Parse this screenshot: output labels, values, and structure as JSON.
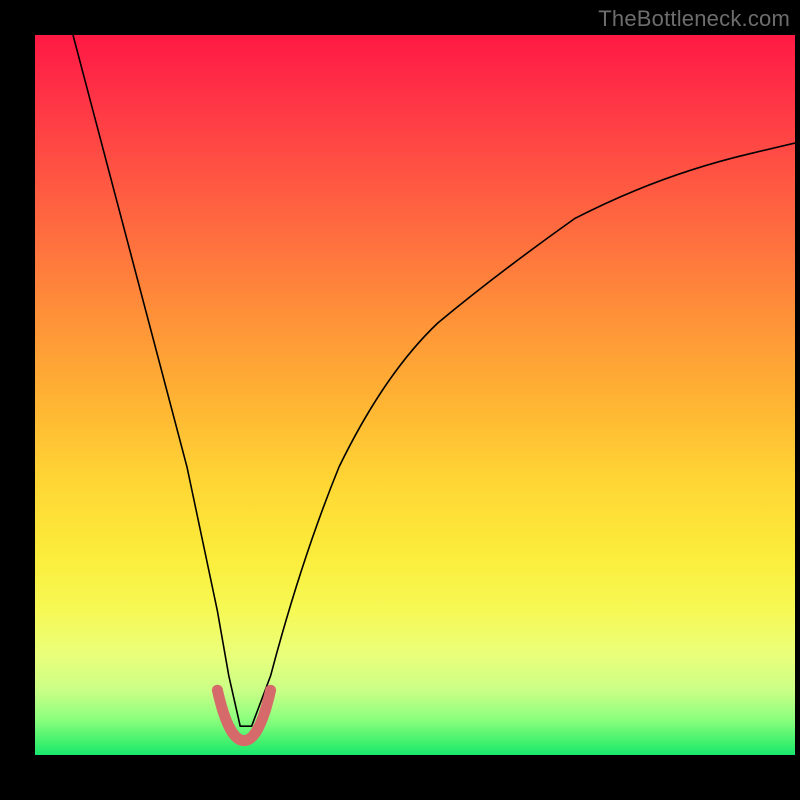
{
  "watermark": "TheBottleneck.com",
  "chart_data": {
    "type": "line",
    "title": "",
    "xlabel": "",
    "ylabel": "",
    "xlim": [
      0,
      100
    ],
    "ylim": [
      0,
      100
    ],
    "grid": false,
    "legend": false,
    "background_gradient": {
      "top": "#ff1943",
      "middle": "#ffd634",
      "bottom": "#18e86e"
    },
    "series": [
      {
        "name": "curve",
        "stroke": "#000000",
        "x": [
          5,
          8,
          11,
          14,
          17,
          20,
          22,
          24,
          25.5,
          27,
          28.5,
          31,
          34,
          37,
          40,
          44,
          48,
          53,
          58,
          64,
          71,
          78,
          86,
          94,
          100
        ],
        "y": [
          100,
          88,
          76,
          64,
          52,
          40,
          30,
          20,
          11,
          4,
          4,
          11,
          22,
          32,
          40,
          48,
          54,
          60,
          65,
          70,
          74.5,
          78,
          81,
          83.5,
          85
        ]
      },
      {
        "name": "highlight-bottom",
        "stroke": "#d66a6a",
        "x": [
          24,
          25,
          26,
          27,
          28,
          29,
          30,
          31
        ],
        "y": [
          9,
          4,
          2,
          2,
          2,
          2,
          4,
          9
        ]
      }
    ],
    "annotations": []
  }
}
